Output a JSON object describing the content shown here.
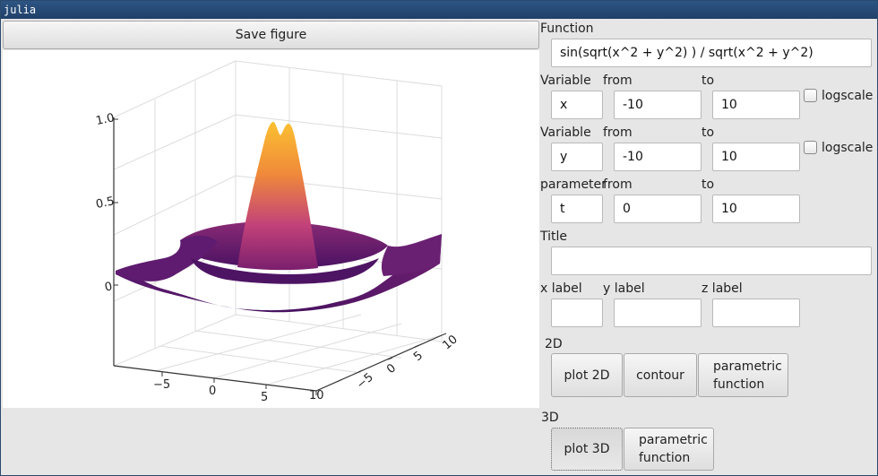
{
  "window": {
    "title": "julia"
  },
  "left": {
    "save_label": "Save figure"
  },
  "plot": {
    "z_ticks": [
      "1.0",
      "0.5",
      "0"
    ],
    "x_ticks": [
      "−5",
      "0",
      "5",
      "10"
    ],
    "y_ticks": [
      "−5",
      "0",
      "5",
      "10"
    ],
    "colors": {
      "low": "#3d0b57",
      "mid": "#c2417a",
      "high": "#fbc030"
    }
  },
  "form": {
    "function_label": "Function",
    "function_value": "sin(sqrt(x^2 + y^2) ) / sqrt(x^2 + y^2)",
    "row1": {
      "label": "Variable",
      "from_label": "from",
      "to_label": "to",
      "var": "x",
      "from": "-10",
      "to": "10",
      "logscale_label": "logscale"
    },
    "row2": {
      "label": "Variable",
      "from_label": "from",
      "to_label": "to",
      "var": "y",
      "from": "-10",
      "to": "10",
      "logscale_label": "logscale"
    },
    "row3": {
      "label": "parameter",
      "from_label": "from",
      "to_label": "to",
      "var": "t",
      "from": "0",
      "to": "10"
    },
    "title_label": "Title",
    "title_value": "",
    "xlabel_label": "x label",
    "ylabel_label": "y label",
    "zlabel_label": "z label",
    "section2d": "2D",
    "section3d": "3D",
    "btn_plot2d": "plot 2D",
    "btn_contour": "contour",
    "btn_param2d": "parametric function",
    "btn_plot3d": "plot 3D",
    "btn_param3d": "parametric function"
  }
}
